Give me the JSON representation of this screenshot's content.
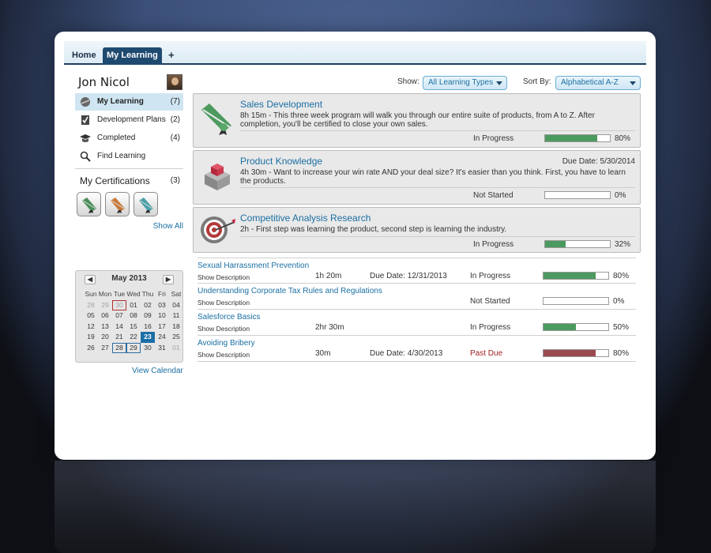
{
  "tabs": {
    "home": "Home",
    "my_learning": "My Learning",
    "add": "+"
  },
  "user": {
    "name": "Jon Nicol"
  },
  "nav": [
    {
      "label": "My Learning",
      "count": "(7)",
      "icon": "graduate-icon"
    },
    {
      "label": "Development Plans",
      "count": "(2)",
      "icon": "checklist-icon"
    },
    {
      "label": "Completed",
      "count": "(4)",
      "icon": "mortarboard-icon"
    },
    {
      "label": "Find Learning",
      "count": "",
      "icon": "search-icon"
    }
  ],
  "certifications": {
    "title": "My Certifications",
    "count": "(3)",
    "show_all": "Show All"
  },
  "calendar": {
    "month": "May 2013",
    "days_of_week": [
      "Sun",
      "Mon",
      "Tue",
      "Wed",
      "Thu",
      "Fri",
      "Sat"
    ],
    "weeks": [
      [
        "28",
        "29",
        "30",
        "01",
        "02",
        "03",
        "04"
      ],
      [
        "05",
        "06",
        "07",
        "08",
        "09",
        "10",
        "11"
      ],
      [
        "12",
        "13",
        "14",
        "15",
        "16",
        "17",
        "18"
      ],
      [
        "19",
        "20",
        "21",
        "22",
        "23",
        "24",
        "25"
      ],
      [
        "26",
        "27",
        "28",
        "29",
        "30",
        "31",
        "01"
      ]
    ],
    "today": "23",
    "view_calendar": "View Calendar"
  },
  "filters": {
    "show_label": "Show:",
    "show_value": "All Learning Types",
    "sort_label": "Sort By:",
    "sort_value": "Alphabetical A-Z"
  },
  "featured": [
    {
      "title": "Sales Development",
      "due": "",
      "desc": "8h 15m  -  This three week program will walk you through our entire suite of products, from A to Z. After completion, you'll be certified to close your own sales.",
      "status": "In Progress",
      "progress": 80,
      "pct": "80%",
      "icon": "ribbon-certificate-icon"
    },
    {
      "title": "Product Knowledge",
      "due": "Due Date: 5/30/2014",
      "desc": "4h 30m  -  Want to increase your win rate AND your deal size? It's easier than you think. First, you have to learn the products.",
      "status": "Not Started",
      "progress": 0,
      "pct": "0%",
      "icon": "cubes-icon"
    },
    {
      "title": "Competitive Analysis Research",
      "due": "",
      "desc": "2h  -  First step was learning the product, second step is learning the industry.",
      "status": "In Progress",
      "progress": 32,
      "pct": "32%",
      "icon": "target-icon"
    }
  ],
  "list": [
    {
      "title": "Sexual Harrassment Prevention",
      "show": "Show Description",
      "duration": "1h 20m",
      "due": "Due Date: 12/31/2013",
      "status": "In Progress",
      "progress": 80,
      "pct": "80%"
    },
    {
      "title": "Understanding Corporate Tax Rules and Regulations",
      "show": "Show Description",
      "duration": "",
      "due": "",
      "status": "Not Started",
      "progress": 0,
      "pct": "0%"
    },
    {
      "title": "Salesforce Basics",
      "show": "Show Description",
      "duration": "2hr 30m",
      "due": "",
      "status": "In Progress",
      "progress": 50,
      "pct": "50%"
    },
    {
      "title": "Avoiding Bribery",
      "show": "Show Description",
      "duration": "30m",
      "due": "Due Date: 4/30/2013",
      "status": "Past Due",
      "progress": 80,
      "pct": "80%"
    }
  ]
}
